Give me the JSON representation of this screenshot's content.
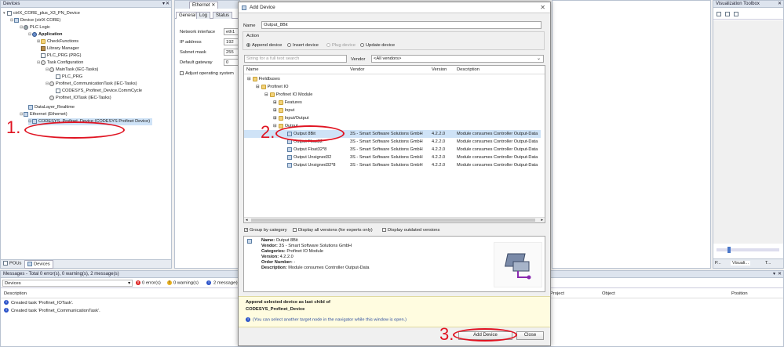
{
  "devices_panel": {
    "title": "Devices",
    "tree": [
      {
        "label": "ctrlX_CORE_plus_X3_PN_Device",
        "icon": "project-icon",
        "bold": false
      },
      {
        "label": "Device (ctrlX CORE)",
        "icon": "device-icon",
        "bold": false
      },
      {
        "label": "PLC Logic",
        "icon": "plc-logic-icon",
        "bold": false
      },
      {
        "label": "Application",
        "icon": "application-icon",
        "bold": true
      },
      {
        "label": "CheckFunctions",
        "icon": "folder-icon",
        "bold": false
      },
      {
        "label": "Library Manager",
        "icon": "library-icon",
        "bold": false
      },
      {
        "label": "PLC_PRG (PRG)",
        "icon": "program-icon",
        "bold": false
      },
      {
        "label": "Task Configuration",
        "icon": "task-config-icon",
        "bold": false
      },
      {
        "label": "MainTask (IEC-Tasks)",
        "icon": "task-icon",
        "bold": false
      },
      {
        "label": "PLC_PRG",
        "icon": "program-icon",
        "bold": false
      },
      {
        "label": "Profinet_CommunicationTask (IEC-Tasks)",
        "icon": "task-icon",
        "bold": false
      },
      {
        "label": "CODESYS_Profinet_Device.CommCycle",
        "icon": "program-icon",
        "bold": false
      },
      {
        "label": "Profinet_IOTask (IEC-Tasks)",
        "icon": "task-icon",
        "bold": false
      },
      {
        "label": "DataLayer_Realtime",
        "icon": "device-icon",
        "bold": false
      },
      {
        "label": "Ethernet (Ethernet)",
        "icon": "ethernet-icon",
        "bold": false
      },
      {
        "label": "CODESYS_Profinet_Device (CODESYS Profinet Device)",
        "icon": "profinet-device-icon",
        "bold": false
      }
    ],
    "bottom_tabs": [
      "POUs",
      "Devices"
    ]
  },
  "editor": {
    "tab_title": "Ethernet",
    "subtabs": [
      "General",
      "Log",
      "Status"
    ],
    "fields": [
      {
        "label": "Network interface",
        "value": "eth1"
      },
      {
        "label": "IP address",
        "value": "192"
      },
      {
        "label": "Subnet mask",
        "value": "255"
      },
      {
        "label": "Default gateway",
        "value": "0"
      }
    ],
    "adjust_label": "Adjust operating system"
  },
  "toolbox": {
    "title": "Visualization Toolbox",
    "bottom_tabs": [
      "P...",
      "Visuali...",
      "T..."
    ]
  },
  "messages": {
    "title": "Messages - Total 0 error(s), 0 warning(s), 2 message(s)",
    "source": "Devices",
    "errors": "0 error(s)",
    "warnings": "0 warning(s)",
    "msgs": "2 message(s)",
    "columns": [
      "Description",
      "Project",
      "Object",
      "Position"
    ],
    "rows": [
      "Created task 'Profinet_IOTask'.",
      "Created task 'Profinet_CommunicationTask'."
    ]
  },
  "dialog": {
    "title": "Add Device",
    "name_label": "Name",
    "name_value": "Output_8Bit",
    "action_label": "Action",
    "actions": [
      {
        "label": "Append device",
        "selected": true,
        "enabled": true
      },
      {
        "label": "Insert device",
        "selected": false,
        "enabled": true
      },
      {
        "label": "Plug device",
        "selected": false,
        "enabled": false
      },
      {
        "label": "Update device",
        "selected": false,
        "enabled": true
      }
    ],
    "search_placeholder": "String for a full text search",
    "vendor_label": "Vendor",
    "vendor_value": "<All vendors>",
    "columns": [
      "Name",
      "Vendor",
      "Version",
      "Description"
    ],
    "tree": [
      {
        "name": "Fieldbuses",
        "vendor": "",
        "version": "",
        "desc": "",
        "indent": 0,
        "expander": "−"
      },
      {
        "name": "Profinet IO",
        "vendor": "",
        "version": "",
        "desc": "",
        "indent": 1,
        "expander": "−"
      },
      {
        "name": "Profinet IO Module",
        "vendor": "",
        "version": "",
        "desc": "",
        "indent": 2,
        "expander": "−"
      },
      {
        "name": "Features",
        "vendor": "",
        "version": "",
        "desc": "",
        "indent": 3,
        "expander": "+"
      },
      {
        "name": "Input",
        "vendor": "",
        "version": "",
        "desc": "",
        "indent": 3,
        "expander": "+"
      },
      {
        "name": "Input/Output",
        "vendor": "",
        "version": "",
        "desc": "",
        "indent": 3,
        "expander": "+"
      },
      {
        "name": "Output",
        "vendor": "",
        "version": "",
        "desc": "",
        "indent": 3,
        "expander": "−"
      },
      {
        "name": "Output 8Bit",
        "vendor": "3S - Smart Software Solutions GmbH",
        "version": "4.2.2.0",
        "desc": "Module consumes Controller Output-Data",
        "indent": 4,
        "expander": ""
      },
      {
        "name": "Output Float32",
        "vendor": "3S - Smart Software Solutions GmbH",
        "version": "4.2.2.0",
        "desc": "Module consumes Controller Output-Data",
        "indent": 4,
        "expander": ""
      },
      {
        "name": "Output Float32*8",
        "vendor": "3S - Smart Software Solutions GmbH",
        "version": "4.2.2.0",
        "desc": "Module consumes Controller Output-Data",
        "indent": 4,
        "expander": ""
      },
      {
        "name": "Output Unsigned32",
        "vendor": "3S - Smart Software Solutions GmbH",
        "version": "4.2.2.0",
        "desc": "Module consumes Controller Output-Data",
        "indent": 4,
        "expander": ""
      },
      {
        "name": "Output Unsigned32*8",
        "vendor": "3S - Smart Software Solutions GmbH",
        "version": "4.2.2.0",
        "desc": "Module consumes Controller Output-Data",
        "indent": 4,
        "expander": ""
      }
    ],
    "group_by_category": "Group by category",
    "display_all_versions": "Display all versions (for experts only)",
    "display_outdated": "Display outdated versions",
    "info": {
      "name": "Output 8Bit",
      "vendor": "3S - Smart Software Solutions GmbH",
      "categories": "Profinet IO Module",
      "version": "4.2.2.0",
      "order_number": "-",
      "description": "Module consumes Controller Output-Data"
    },
    "info_labels": {
      "name": "Name:",
      "vendor": "Vendor:",
      "categories": "Categories:",
      "version": "Version:",
      "order_number": "Order Number:",
      "description": "Description:"
    },
    "append_text": "Append selected device as last child of",
    "append_target": "CODESYS_Profinet_Device",
    "hint": "(You can select another target node in the navigator while this window is open.)",
    "add_button": "Add Device",
    "close_button": "Close"
  },
  "annotations": {
    "step1": "1.",
    "step2": "2.",
    "step3": "3."
  },
  "colors": {
    "annotation_red": "#e01422",
    "selection_blue": "#cfe3f7",
    "info_bg": "#fffce0"
  }
}
